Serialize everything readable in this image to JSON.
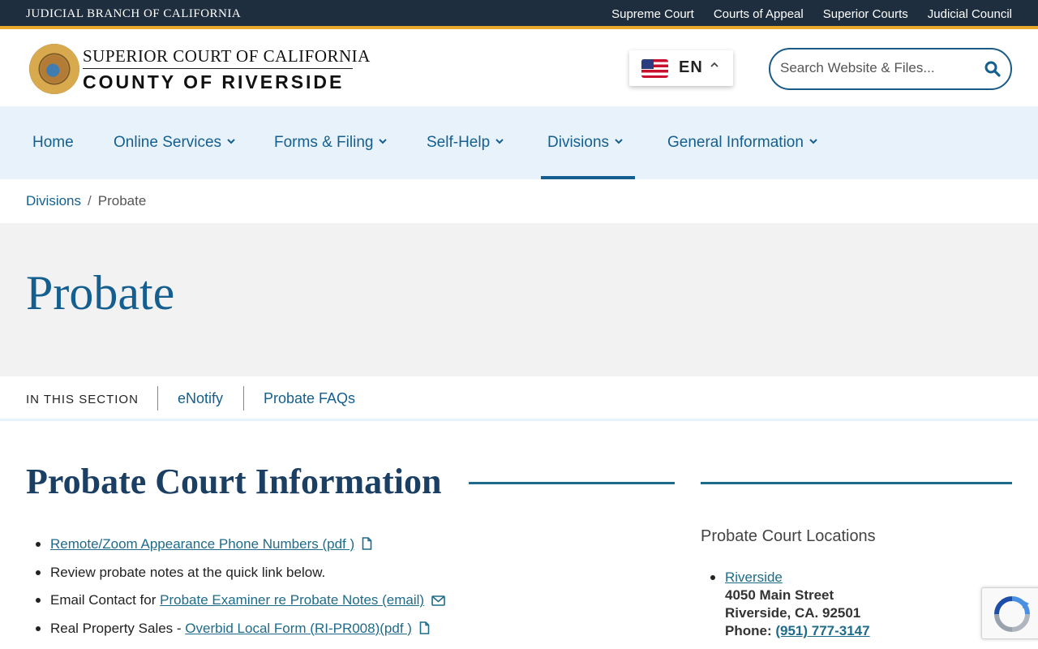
{
  "topbar": {
    "branch": "JUDICIAL BRANCH OF CALIFORNIA",
    "links": [
      "Supreme Court",
      "Courts of Appeal",
      "Superior Courts",
      "Judicial Council"
    ]
  },
  "header": {
    "logo_line1": "SUPERIOR COURT OF CALIFORNIA",
    "logo_line2": "COUNTY OF RIVERSIDE",
    "language": "EN",
    "search_placeholder": "Search Website & Files..."
  },
  "nav": {
    "items": [
      "Home",
      "Online Services",
      "Forms & Filing",
      "Self-Help",
      "Divisions",
      "General Information"
    ],
    "active": "Divisions"
  },
  "breadcrumb": {
    "parent": "Divisions",
    "separator": "/",
    "current": "Probate"
  },
  "hero": {
    "title": "Probate"
  },
  "section_nav": {
    "label": "IN THIS SECTION",
    "links": [
      "eNotify",
      "Probate FAQs"
    ]
  },
  "main": {
    "title": "Probate Court Information",
    "items": [
      {
        "text": "",
        "link": "Remote/Zoom Appearance Phone Numbers (pdf )",
        "icon": "file-icon"
      },
      {
        "text": "Review probate notes at the quick link below.",
        "link": "",
        "icon": ""
      },
      {
        "text": "Email Contact for ",
        "link": "Probate Examiner re Probate Notes  (email)",
        "icon": "mail-icon"
      },
      {
        "text": "Real Property Sales - ",
        "link": "Overbid Local Form (RI-PR008)(pdf )",
        "icon": "file-icon"
      }
    ]
  },
  "sidebar": {
    "heading": "Probate Court Locations",
    "location": {
      "name": "Riverside",
      "street": "4050 Main Street",
      "city": "Riverside, CA. 92501",
      "phone_label": "Phone: ",
      "phone": "(951) 777-3147"
    }
  },
  "colors": {
    "topbar": "#1e2e3f",
    "accent_gold": "#e9a92b",
    "link_blue": "#145f8f",
    "nav_bg": "#e8f2fa"
  }
}
